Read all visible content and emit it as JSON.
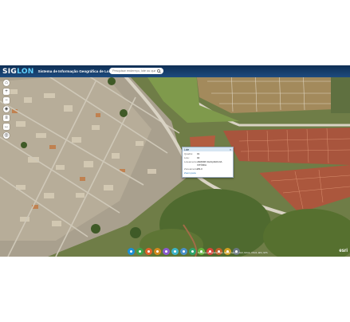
{
  "header": {
    "logo": {
      "part1": "SIG",
      "part2": "LON"
    },
    "title": "Sistema de Informação Geográfica de Londrina"
  },
  "search": {
    "placeholder": "Pesquisar endereço, lote ou quadra"
  },
  "left_tools": [
    {
      "icon": "home-icon",
      "glyph": "⌂"
    },
    {
      "icon": "zoom-in-icon",
      "glyph": "+"
    },
    {
      "icon": "zoom-out-icon",
      "glyph": "−"
    },
    {
      "icon": "compass-icon",
      "glyph": "◈"
    },
    {
      "icon": "layers-icon",
      "glyph": "≡"
    },
    {
      "icon": "measure-icon",
      "glyph": "↔"
    },
    {
      "icon": "locate-icon",
      "glyph": "◎"
    }
  ],
  "popup": {
    "title": "Lote",
    "close": "×",
    "rows": [
      {
        "key": "Quadra:",
        "value": "01"
      },
      {
        "key": "Lote:",
        "value": "02"
      },
      {
        "key": "Loteamento:",
        "value": "JARDIM CHAÇARA DA VITÓRIA"
      },
      {
        "key": "Zoneamento:",
        "value": "ZR-3"
      }
    ],
    "footer": "Zoom para"
  },
  "bottom_toolbar": [
    {
      "icon": "info-icon",
      "color": "#1b8fd6"
    },
    {
      "icon": "edit-icon",
      "color": "#3aa34a"
    },
    {
      "icon": "grid-icon",
      "color": "#e0612b"
    },
    {
      "icon": "ruler-icon",
      "color": "#d28a1e"
    },
    {
      "icon": "layers-icon",
      "color": "#8a5bd0"
    },
    {
      "icon": "globe-icon",
      "color": "#3cb4c8"
    },
    {
      "icon": "map-icon",
      "color": "#4a90c8"
    },
    {
      "icon": "chart-icon",
      "color": "#2fa36b"
    },
    {
      "icon": "pin-icon",
      "color": "#64b33d"
    },
    {
      "icon": "draw-icon",
      "color": "#d8453a"
    },
    {
      "icon": "camera-icon",
      "color": "#c05f2a"
    },
    {
      "icon": "share-icon",
      "color": "#d1a021"
    },
    {
      "icon": "print-icon",
      "color": "#6a7781"
    }
  ],
  "attribution": "Prefeitura de Londrina, Esri, HERE, Garmin, FAO, NOAA, USGS, EPA, NPS",
  "esri": "esri"
}
